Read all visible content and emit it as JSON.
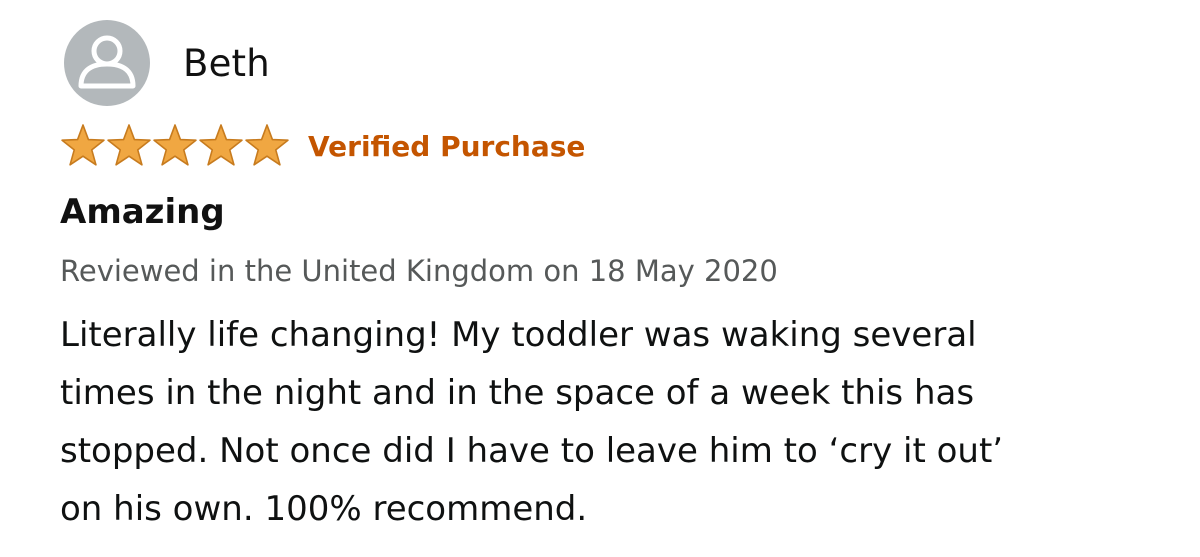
{
  "review": {
    "author": {
      "name": "Beth",
      "avatar_icon": "user-silhouette-icon"
    },
    "rating": {
      "stars": 5,
      "max_stars": 5,
      "star_color": "#f0a742",
      "star_outline": "#c77b1e",
      "verified_label": "Verified Purchase",
      "verified_color": "#c45500"
    },
    "title": "Amazing",
    "meta": "Reviewed in the United Kingdom on 18 May 2020",
    "body_lines": [
      "Literally life changing! My toddler was waking several",
      "times in the night and in the space of a week this has",
      "stopped. Not once did I have to leave him to ‘cry it out’",
      "on his own. 100% recommend."
    ]
  }
}
